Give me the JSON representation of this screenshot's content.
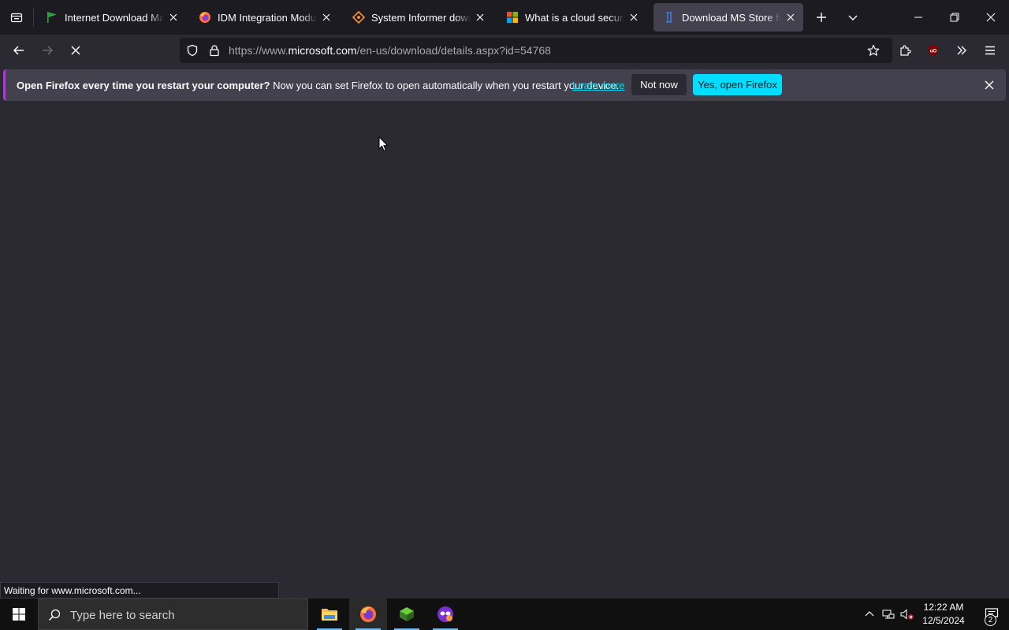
{
  "tabs": [
    {
      "title": "Internet Download Manager",
      "active": false,
      "favicon": "idm-flag-icon"
    },
    {
      "title": "IDM Integration Module – Firefox",
      "active": false,
      "favicon": "firefox-icon"
    },
    {
      "title": "System Informer download",
      "active": false,
      "favicon": "system-informer-icon"
    },
    {
      "title": "What is a cloud security solution",
      "active": false,
      "favicon": "microsoft-icon"
    },
    {
      "title": "Download MS Store from",
      "active": true,
      "favicon": "page-icon"
    }
  ],
  "navbar": {
    "url_prefix": "https://www.",
    "url_domain": "microsoft.com",
    "url_path": "/en-us/download/details.aspx?id=54768"
  },
  "notification": {
    "bold_text": "Open Firefox every time you restart your computer?",
    "text": " Now you can set Firefox to open automatically when you restart your device.",
    "link": "Learn more",
    "not_now": "Not now",
    "yes": "Yes, open Firefox"
  },
  "status": "Waiting for www.microsoft.com...",
  "taskbar": {
    "search_placeholder": "Type here to search",
    "time": "12:22 AM",
    "date": "12/5/2024",
    "notification_count": "2"
  },
  "colors": {
    "accent": "#00ddff",
    "background": "#2b2a33",
    "tabstrip": "#1c1b22"
  }
}
